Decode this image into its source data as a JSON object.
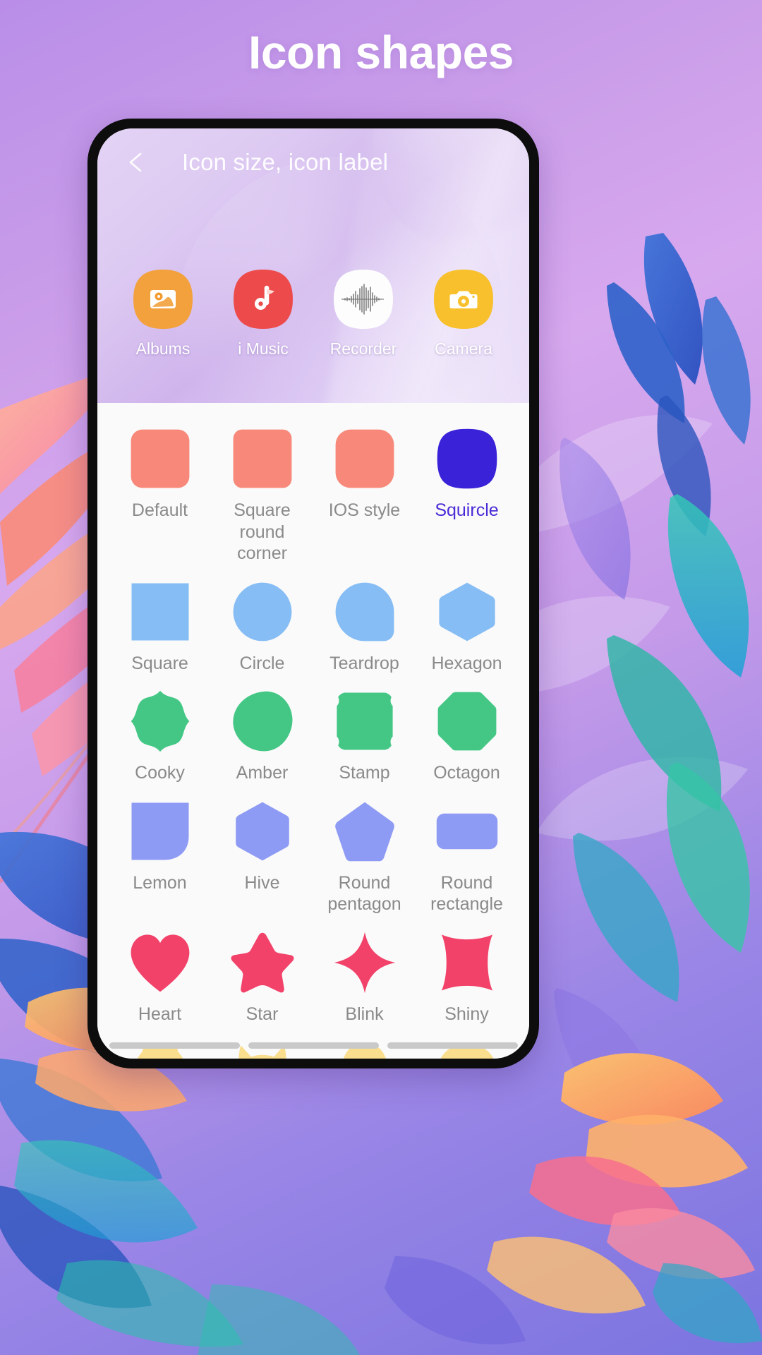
{
  "page": {
    "title": "Icon shapes"
  },
  "appbar": {
    "back_icon": "arrow-left-icon",
    "title": "Icon size, icon label"
  },
  "preview": {
    "apps": [
      {
        "label": "Albums",
        "icon": "albums-icon",
        "bg": "#F2A13C"
      },
      {
        "label": "i Music",
        "icon": "music-icon",
        "bg": "#ED4B4B"
      },
      {
        "label": "Recorder",
        "icon": "recorder-icon",
        "bg": "#FDFDFD"
      },
      {
        "label": "Camera",
        "icon": "camera-icon",
        "bg": "#F7C02C"
      }
    ]
  },
  "shapes": {
    "selected": "Squircle",
    "selected_color": "#4b2bd6",
    "items": [
      {
        "label": "Default",
        "shape": "default",
        "color": "#F8897A"
      },
      {
        "label": "Square round corner",
        "shape": "square-round-corner",
        "color": "#F8897A"
      },
      {
        "label": "IOS style",
        "shape": "ios-style",
        "color": "#F8897A"
      },
      {
        "label": "Squircle",
        "shape": "squircle",
        "color": "#3A22D8",
        "selected": true
      },
      {
        "label": "Square",
        "shape": "square",
        "color": "#86BDF5"
      },
      {
        "label": "Circle",
        "shape": "circle",
        "color": "#86BDF5"
      },
      {
        "label": "Teardrop",
        "shape": "teardrop",
        "color": "#86BDF5"
      },
      {
        "label": "Hexagon",
        "shape": "hexagon",
        "color": "#86BDF5"
      },
      {
        "label": "Cooky",
        "shape": "cooky",
        "color": "#44C785"
      },
      {
        "label": "Amber",
        "shape": "amber",
        "color": "#44C785"
      },
      {
        "label": "Stamp",
        "shape": "stamp",
        "color": "#44C785"
      },
      {
        "label": "Octagon",
        "shape": "octagon",
        "color": "#44C785"
      },
      {
        "label": "Lemon",
        "shape": "lemon",
        "color": "#8E9BF4"
      },
      {
        "label": "Hive",
        "shape": "hive",
        "color": "#8E9BF4"
      },
      {
        "label": "Round pentagon",
        "shape": "round-pentagon",
        "color": "#8E9BF4"
      },
      {
        "label": "Round rectangle",
        "shape": "round-rectangle",
        "color": "#8E9BF4"
      },
      {
        "label": "Heart",
        "shape": "heart",
        "color": "#F2426A"
      },
      {
        "label": "Star",
        "shape": "star",
        "color": "#F2426A"
      },
      {
        "label": "Blink",
        "shape": "blink",
        "color": "#F2426A"
      },
      {
        "label": "Shiny",
        "shape": "shiny",
        "color": "#F2426A"
      },
      {
        "label": "",
        "shape": "bear",
        "color": "#F9DE8E"
      },
      {
        "label": "",
        "shape": "cat",
        "color": "#F9DE8E"
      },
      {
        "label": "",
        "shape": "penguin",
        "color": "#F9DE8E"
      },
      {
        "label": "",
        "shape": "chat",
        "color": "#F9DE8E"
      }
    ]
  }
}
